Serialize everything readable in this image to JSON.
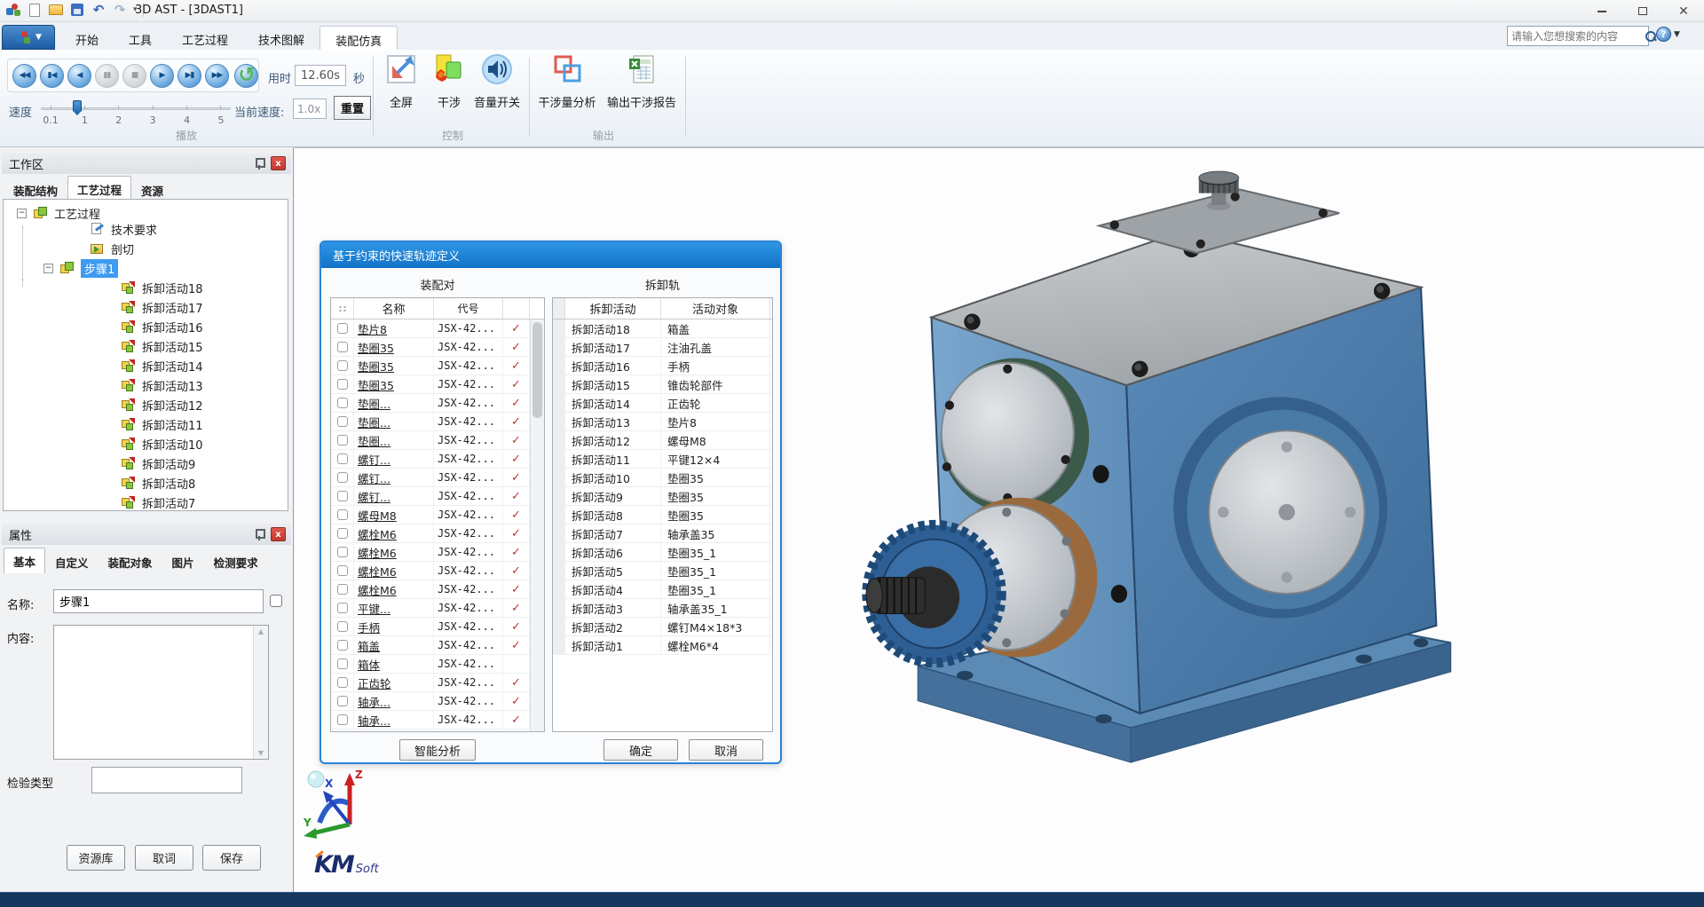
{
  "colors": {
    "accent_blue": "#2f74c0",
    "dialog_header_blue": "#1173c8",
    "selection_blue": "#3e9bf0",
    "check_red": "#c8312b",
    "statusbar_navy": "#17375e",
    "loop_green": "#55b85f"
  },
  "titlebar": {
    "title": "3D AST - [3DAST1]"
  },
  "ribbon": {
    "tabs": [
      "开始",
      "工具",
      "工艺过程",
      "技术图解",
      "装配仿真"
    ],
    "active_tab": "装配仿真",
    "search_placeholder": "请输入您想搜索的内容"
  },
  "toolbar": {
    "playback_buttons": [
      {
        "id": "skip-to-start-button",
        "glyph": "◀◀"
      },
      {
        "id": "step-back-button",
        "glyph": "▮◀"
      },
      {
        "id": "play-backward-button",
        "glyph": "◀"
      },
      {
        "id": "pause-button",
        "glyph": "▮▮",
        "disabled": true
      },
      {
        "id": "stop-button",
        "glyph": "■",
        "disabled": true
      },
      {
        "id": "play-button",
        "glyph": "▶"
      },
      {
        "id": "step-forward-button",
        "glyph": "▶▮"
      },
      {
        "id": "fast-forward-button",
        "glyph": "▶▶"
      },
      {
        "id": "replay-button",
        "glyph": "↺",
        "loop": true
      }
    ],
    "elapsed_label": "用时",
    "elapsed_value": "12.60s",
    "elapsed_unit": "秒",
    "speed_label": "速度",
    "speed_ticks": [
      "0.1",
      "1",
      "2",
      "3",
      "4",
      "5"
    ],
    "current_speed_label": "当前速度:",
    "current_speed_value": "1.0x",
    "reset_label": "重置",
    "fullscreen_label": "全屏",
    "interference_label": "干涉",
    "volume_label": "音量开关",
    "interference_analysis_label": "干涉量分析",
    "interference_report_label": "输出干涉报告",
    "group_play": "播放",
    "group_control": "控制",
    "group_output": "输出"
  },
  "workspace": {
    "title": "工作区",
    "tabs": [
      "装配结构",
      "工艺过程",
      "资源"
    ],
    "active_tab": "工艺过程",
    "tree": {
      "root": "工艺过程",
      "tech_req": "技术要求",
      "section": "剖切",
      "step": "步骤1",
      "activities": [
        "拆卸活动18",
        "拆卸活动17",
        "拆卸活动16",
        "拆卸活动15",
        "拆卸活动14",
        "拆卸活动13",
        "拆卸活动12",
        "拆卸活动11",
        "拆卸活动10",
        "拆卸活动9",
        "拆卸活动8",
        "拆卸活动7"
      ]
    }
  },
  "properties": {
    "title": "属性",
    "tabs": [
      "基本",
      "自定义",
      "装配对象",
      "图片",
      "检测要求"
    ],
    "active_tab": "基本",
    "name_label": "名称:",
    "name_value": "步骤1",
    "content_label": "内容:",
    "content_value": "",
    "check_type_label": "检验类型",
    "check_type_value": "",
    "buttons": [
      "资源库",
      "取词",
      "保存"
    ]
  },
  "dialog": {
    "title": "基于约束的快速轨迹定义",
    "left_group": "装配对",
    "right_group": "拆卸轨",
    "left_columns": {
      "name": "名称",
      "code": "代号"
    },
    "right_columns": {
      "activity": "拆卸活动",
      "target": "活动对象"
    },
    "left_rows": [
      {
        "name": "垫片8",
        "code": "JSX-42...",
        "checked": true
      },
      {
        "name": "垫圈35",
        "code": "JSX-42...",
        "checked": true
      },
      {
        "name": "垫圈35",
        "code": "JSX-42...",
        "checked": true
      },
      {
        "name": "垫圈35",
        "code": "JSX-42...",
        "checked": true
      },
      {
        "name": "垫圈...",
        "code": "JSX-42...",
        "checked": true
      },
      {
        "name": "垫圈...",
        "code": "JSX-42...",
        "checked": true
      },
      {
        "name": "垫圈...",
        "code": "JSX-42...",
        "checked": true
      },
      {
        "name": "螺钉...",
        "code": "JSX-42...",
        "checked": true
      },
      {
        "name": "螺钉...",
        "code": "JSX-42...",
        "checked": true
      },
      {
        "name": "螺钉...",
        "code": "JSX-42...",
        "checked": true
      },
      {
        "name": "螺母M8",
        "code": "JSX-42...",
        "checked": true
      },
      {
        "name": "螺栓M6",
        "code": "JSX-42...",
        "checked": true
      },
      {
        "name": "螺栓M6",
        "code": "JSX-42...",
        "checked": true
      },
      {
        "name": "螺栓M6",
        "code": "JSX-42...",
        "checked": true
      },
      {
        "name": "螺栓M6",
        "code": "JSX-42...",
        "checked": true
      },
      {
        "name": "平键...",
        "code": "JSX-42...",
        "checked": true
      },
      {
        "name": "手柄",
        "code": "JSX-42...",
        "checked": true
      },
      {
        "name": "箱盖",
        "code": "JSX-42...",
        "checked": true
      },
      {
        "name": "箱体",
        "code": "JSX-42...",
        "checked": false
      },
      {
        "name": "正齿轮",
        "code": "JSX-42...",
        "checked": true
      },
      {
        "name": "轴承...",
        "code": "JSX-42...",
        "checked": true
      },
      {
        "name": "轴承...",
        "code": "JSX-42...",
        "checked": true
      }
    ],
    "right_rows": [
      {
        "activity": "拆卸活动18",
        "target": "箱盖"
      },
      {
        "activity": "拆卸活动17",
        "target": "注油孔盖"
      },
      {
        "activity": "拆卸活动16",
        "target": "手柄"
      },
      {
        "activity": "拆卸活动15",
        "target": "锥齿轮部件"
      },
      {
        "activity": "拆卸活动14",
        "target": "正齿轮"
      },
      {
        "activity": "拆卸活动13",
        "target": "垫片8"
      },
      {
        "activity": "拆卸活动12",
        "target": "螺母M8"
      },
      {
        "activity": "拆卸活动11",
        "target": "平键12×4"
      },
      {
        "activity": "拆卸活动10",
        "target": "垫圈35"
      },
      {
        "activity": "拆卸活动9",
        "target": "垫圈35"
      },
      {
        "activity": "拆卸活动8",
        "target": "垫圈35"
      },
      {
        "activity": "拆卸活动7",
        "target": "轴承盖35"
      },
      {
        "activity": "拆卸活动6",
        "target": "垫圈35_1"
      },
      {
        "activity": "拆卸活动5",
        "target": "垫圈35_1"
      },
      {
        "activity": "拆卸活动4",
        "target": "垫圈35_1"
      },
      {
        "activity": "拆卸活动3",
        "target": "轴承盖35_1"
      },
      {
        "activity": "拆卸活动2",
        "target": "螺钉M4×18*3"
      },
      {
        "activity": "拆卸活动1",
        "target": "螺栓M6*4"
      }
    ],
    "analyze_label": "智能分析",
    "ok_label": "确定",
    "cancel_label": "取消"
  },
  "viewport": {
    "logo_km": "KM",
    "logo_soft": "Soft",
    "axis_x": "X",
    "axis_y": "Y",
    "axis_z": "Z"
  }
}
